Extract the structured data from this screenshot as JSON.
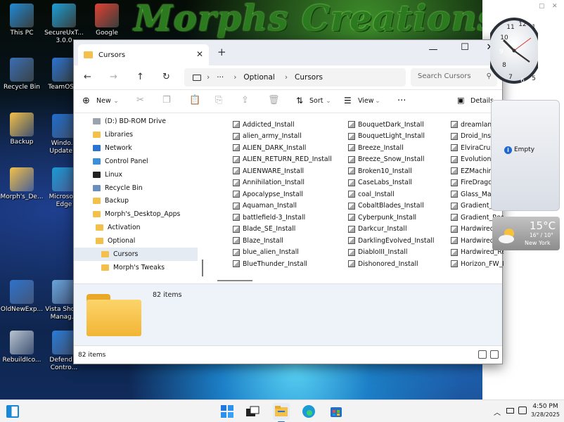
{
  "wallpaper": {
    "title": "Morphs Creations"
  },
  "desktop_icons": [
    {
      "label": "This PC",
      "color": "#1f8ad8"
    },
    {
      "label": "SecureUxT...\n3.0.0",
      "color": "#1aa0d8"
    },
    {
      "label": "Google",
      "color": "#e34133"
    },
    {
      "label": "Recycle Bin",
      "color": "#3a6fb5"
    },
    {
      "label": "TeamOS...",
      "color": "#2b73d1"
    },
    {
      "label": "Backup",
      "color": "#f3c14b"
    },
    {
      "label": "Windo...\nUpdate...",
      "color": "#1f6fd0"
    },
    {
      "label": "Morph's_De...",
      "color": "#f3c14b"
    },
    {
      "label": "Microso...\nEdge",
      "color": "#1b9ad6"
    },
    {
      "label": "OldNewExp...",
      "color": "#2f72c9"
    },
    {
      "label": "Vista Shor...\nManag...",
      "color": "#6aa5d9"
    },
    {
      "label": "RebuildIco...",
      "color": "#b8c4d0"
    },
    {
      "label": "Defend...\nContro...",
      "color": "#2a7bd6"
    }
  ],
  "explorer": {
    "tab_title": "Cursors",
    "nav": {
      "back": "←",
      "forward": "→",
      "up": "↑",
      "refresh": "↻"
    },
    "breadcrumb": {
      "ellipsis": "···",
      "parent": "Optional",
      "current": "Cursors",
      "sep": "›"
    },
    "search_placeholder": "Search Cursors",
    "toolbar": {
      "new": "New",
      "sort": "Sort",
      "view": "View",
      "more": "···",
      "details": "Details"
    },
    "nav_pane": [
      {
        "label": "(D:) BD-ROM Drive",
        "indent": 1,
        "kind": "drive"
      },
      {
        "label": "Libraries",
        "indent": 1,
        "kind": "folder"
      },
      {
        "label": "Network",
        "indent": 1,
        "kind": "network"
      },
      {
        "label": "Control Panel",
        "indent": 1,
        "kind": "control"
      },
      {
        "label": "Linux",
        "indent": 1,
        "kind": "linux"
      },
      {
        "label": "Recycle Bin",
        "indent": 1,
        "kind": "bin"
      },
      {
        "label": "Backup",
        "indent": 1,
        "kind": "folder"
      },
      {
        "label": "Morph's_Desktop_Apps",
        "indent": 1,
        "kind": "folder"
      },
      {
        "label": "Activation",
        "indent": 2,
        "kind": "folder"
      },
      {
        "label": "Optional",
        "indent": 2,
        "kind": "folder"
      },
      {
        "label": "Cursors",
        "indent": 3,
        "kind": "folder",
        "selected": true
      },
      {
        "label": "Morph's Tweaks",
        "indent": 3,
        "kind": "folder"
      }
    ],
    "files": [
      [
        "Addicted_Install",
        "alien_army_Install",
        "ALIEN_DARK_Install",
        "ALIEN_RETURN_RED_Install",
        "ALIENWARE_Install",
        "Annihilation_Install",
        "Apocalypse_Install",
        "Aquaman_Install",
        "battlefield-3_Install",
        "Blade_SE_Install",
        "Blaze_Install",
        "blue_alien_Install",
        "BlueThunder_Install"
      ],
      [
        "BouquetDark_Install",
        "BouquetLight_Install",
        "Breeze_Install",
        "Breeze_Snow_Install",
        "Broken10_Install",
        "CaseLabs_Install",
        "coal_Install",
        "CobaltBlades_Install",
        "Cyberpunk_Install",
        "Darkcur_Install",
        "DarklingEvolved_Install",
        "DiabloIII_Install",
        "Dishonored_Install"
      ],
      [
        "dreamlandGRE",
        "Droid_Install",
        "ElviraCrushed",
        "Evolution_Inst",
        "EZMachine_In",
        "FireDragon_In",
        "Glass_Maxx_In",
        "Gradient_Blue",
        "Gradient_Red_",
        "Hardwired_Blu",
        "Hardwired_Ins",
        "Hardwired_Re",
        "Horizon_FW_I"
      ]
    ],
    "details_count": "82 items",
    "status_count": "82 items"
  },
  "widgets": {
    "gadget_label": "Empty",
    "weather": {
      "temp": "15°C",
      "range": "16° / 10°",
      "city": "New York"
    }
  },
  "taskbar": {
    "clock_time": "4:50 PM",
    "clock_date": "3/28/2025",
    "tray_icons": [
      "chevron-up",
      "battery",
      "network"
    ]
  }
}
